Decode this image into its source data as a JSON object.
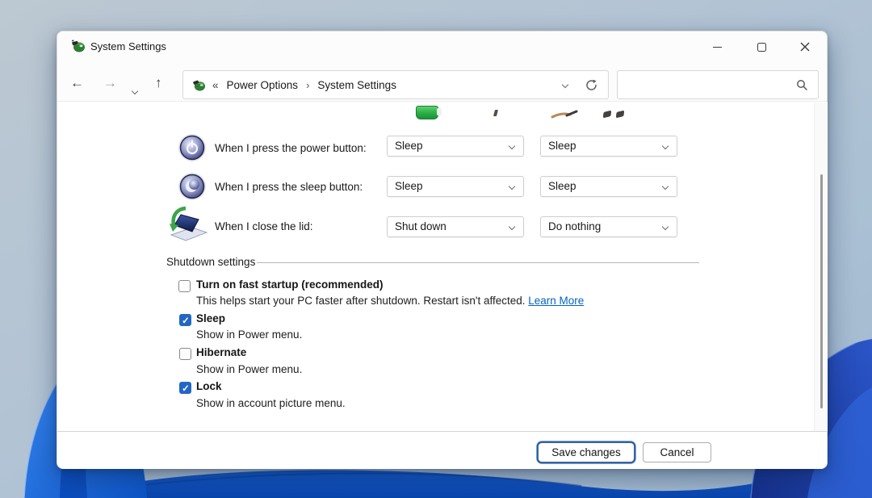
{
  "window": {
    "title": "System Settings"
  },
  "icons": {
    "back": "←",
    "forward": "→",
    "up": "↑"
  },
  "address": {
    "prefix": "«",
    "crumb1": "Power Options",
    "separator": "›",
    "crumb2": "System Settings"
  },
  "search": {
    "value": ""
  },
  "content": {
    "rows": [
      {
        "label": "When I press the power button:",
        "on_battery": "Sleep",
        "plugged_in": "Sleep"
      },
      {
        "label": "When I press the sleep button:",
        "on_battery": "Sleep",
        "plugged_in": "Sleep"
      },
      {
        "label": "When I close the lid:",
        "on_battery": "Shut down",
        "plugged_in": "Do nothing"
      }
    ],
    "shutdown": {
      "heading": "Shutdown settings",
      "fast_startup": {
        "label": "Turn on fast startup (recommended)",
        "checked": false,
        "description": "This helps start your PC faster after shutdown. Restart isn't affected. ",
        "link": "Learn More"
      },
      "options": [
        {
          "label": "Sleep",
          "checked": true,
          "description": "Show in Power menu."
        },
        {
          "label": "Hibernate",
          "checked": false,
          "description": "Show in Power menu."
        },
        {
          "label": "Lock",
          "checked": true,
          "description": "Show in account picture menu."
        }
      ]
    }
  },
  "footer": {
    "save": "Save changes",
    "cancel": "Cancel"
  },
  "colors": {
    "accent": "#1b66c9",
    "link": "#0563c1",
    "checkbox_checked": "#2267c4",
    "wallpaper_blue": "#1a6ae4"
  }
}
